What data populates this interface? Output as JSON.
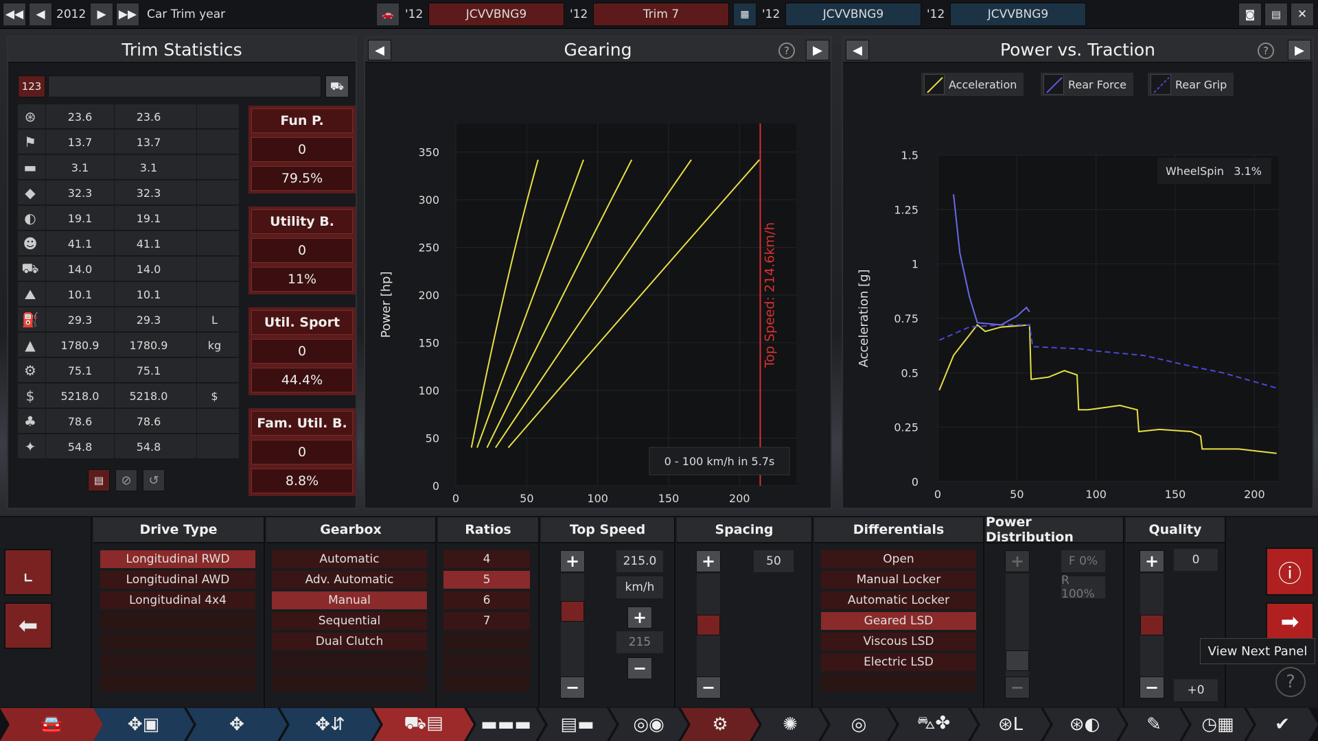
{
  "topbar": {
    "year": "2012",
    "car_trim_year_label": "Car Trim year",
    "slot1_year": "'12",
    "slot1_name": "JCVVBNG9",
    "slot2_year": "'12",
    "slot2_name": "Trim 7",
    "slot3_year": "'12",
    "slot3_name": "JCVVBNG9",
    "slot4_year": "'12",
    "slot4_name": "JCVVBNG9"
  },
  "trim_stats": {
    "title": "Trim Statistics",
    "search_prefix": "123",
    "rows": [
      {
        "icon": "steering-wheel-icon",
        "v1": "23.6",
        "v2": "23.6",
        "unit": ""
      },
      {
        "icon": "race-flag-icon",
        "v1": "13.7",
        "v2": "13.7",
        "unit": ""
      },
      {
        "icon": "seat-icon",
        "v1": "3.1",
        "v2": "3.1",
        "unit": ""
      },
      {
        "icon": "diamond-icon",
        "v1": "32.3",
        "v2": "32.3",
        "unit": ""
      },
      {
        "icon": "safety-icon",
        "v1": "19.1",
        "v2": "19.1",
        "unit": ""
      },
      {
        "icon": "passengers-icon",
        "v1": "41.1",
        "v2": "41.1",
        "unit": ""
      },
      {
        "icon": "cargo-icon",
        "v1": "14.0",
        "v2": "14.0",
        "unit": ""
      },
      {
        "icon": "offroad-icon",
        "v1": "10.1",
        "v2": "10.1",
        "unit": ""
      },
      {
        "icon": "fuel-icon",
        "v1": "29.3",
        "v2": "29.3",
        "unit": "L"
      },
      {
        "icon": "weight-icon",
        "v1": "1780.9",
        "v2": "1780.9",
        "unit": "kg"
      },
      {
        "icon": "service-icon",
        "v1": "75.1",
        "v2": "75.1",
        "unit": ""
      },
      {
        "icon": "cost-icon",
        "v1": "5218.0",
        "v2": "5218.0",
        "unit": "$"
      },
      {
        "icon": "environment-icon",
        "v1": "78.6",
        "v2": "78.6",
        "unit": ""
      },
      {
        "icon": "engineering-icon",
        "v1": "54.8",
        "v2": "54.8",
        "unit": ""
      }
    ],
    "scores": [
      {
        "name": "Fun P.",
        "rank": "0",
        "pct": "79.5%"
      },
      {
        "name": "Utility B.",
        "rank": "0",
        "pct": "11%"
      },
      {
        "name": "Util. Sport",
        "rank": "0",
        "pct": "44.4%"
      },
      {
        "name": "Fam. Util. B.",
        "rank": "0",
        "pct": "8.8%"
      }
    ]
  },
  "gearing": {
    "title": "Gearing",
    "top_speed_label": "Top Speed: 214.6km/h",
    "accel_label": "0 - 100 km/h in 5.7s"
  },
  "power_traction": {
    "title": "Power vs. Traction",
    "legend": [
      "Acceleration",
      "Rear Force",
      "Rear Grip"
    ],
    "wheelspin_label": "WheelSpin",
    "wheelspin_value": "3.1%"
  },
  "chart_data": [
    {
      "type": "line",
      "title": "Gearing",
      "xlabel": "Speed [km/h]",
      "ylabel": "Power [hp]",
      "xlim": [
        0,
        240
      ],
      "ylim": [
        0,
        380
      ],
      "xticks": [
        0,
        50,
        100,
        150,
        200
      ],
      "yticks": [
        0,
        50,
        100,
        150,
        200,
        250,
        300,
        350
      ],
      "series": [
        {
          "x": [
            11,
            35,
            58
          ],
          "y": [
            40,
            220,
            342
          ]
        },
        {
          "x": [
            15,
            55,
            90
          ],
          "y": [
            40,
            200,
            342
          ]
        },
        {
          "x": [
            22,
            75,
            124
          ],
          "y": [
            40,
            200,
            342
          ]
        },
        {
          "x": [
            28,
            100,
            166
          ],
          "y": [
            40,
            200,
            342
          ]
        },
        {
          "x": [
            37,
            130,
            214
          ],
          "y": [
            40,
            200,
            342
          ]
        }
      ],
      "top_speed": 214.6,
      "annotations": [
        "Top Speed: 214.6km/h",
        "0 - 100 km/h in 5.7s"
      ]
    },
    {
      "type": "line",
      "title": "Power vs. Traction",
      "xlabel": "Speed [km/h]",
      "ylabel": "Acceleration [g]",
      "xlim": [
        0,
        215
      ],
      "ylim": [
        0,
        1.5
      ],
      "xticks": [
        0,
        50,
        100,
        150,
        200
      ],
      "yticks": [
        "0",
        "0.25",
        "0.5",
        "0.75",
        "1",
        "1.25",
        "1.5"
      ],
      "series": [
        {
          "name": "Acceleration",
          "x": [
            1,
            10,
            25,
            30,
            40,
            58,
            59,
            70,
            80,
            88,
            89,
            95,
            105,
            115,
            126,
            127,
            140,
            160,
            166,
            167,
            190,
            214
          ],
          "y": [
            0.42,
            0.58,
            0.72,
            0.69,
            0.71,
            0.72,
            0.47,
            0.48,
            0.51,
            0.49,
            0.33,
            0.33,
            0.34,
            0.35,
            0.33,
            0.23,
            0.24,
            0.23,
            0.21,
            0.15,
            0.15,
            0.13
          ]
        },
        {
          "name": "Rear Force",
          "x": [
            1,
            20,
            40,
            58,
            60,
            90,
            100,
            130,
            160,
            180,
            214
          ],
          "y": [
            0.65,
            0.71,
            0.72,
            0.72,
            0.62,
            0.61,
            0.6,
            0.58,
            0.53,
            0.5,
            0.43
          ]
        },
        {
          "name": "Rear Grip",
          "x": [
            10,
            14,
            20,
            25,
            40,
            50,
            56,
            58
          ],
          "y": [
            1.32,
            1.05,
            0.85,
            0.73,
            0.72,
            0.76,
            0.8,
            0.78
          ]
        }
      ],
      "annotations": [
        "WheelSpin 3.1%"
      ]
    }
  ],
  "bottom": {
    "drive_type": {
      "title": "Drive Type",
      "options": [
        "Longitudinal RWD",
        "Longitudinal AWD",
        "Longitudinal 4x4"
      ],
      "selected": "Longitudinal RWD"
    },
    "gearbox": {
      "title": "Gearbox",
      "options": [
        "Automatic",
        "Adv. Automatic",
        "Manual",
        "Sequential",
        "Dual Clutch"
      ],
      "selected": "Manual"
    },
    "ratios": {
      "title": "Ratios",
      "options": [
        "4",
        "5",
        "6",
        "7"
      ],
      "selected": "5"
    },
    "top_speed": {
      "title": "Top Speed",
      "value": "215.0",
      "unit": "km/h",
      "secondary": "215"
    },
    "spacing": {
      "title": "Spacing",
      "value": "50"
    },
    "differentials": {
      "title": "Differentials",
      "options": [
        "Open",
        "Manual Locker",
        "Automatic Locker",
        "Geared LSD",
        "Viscous LSD",
        "Electric LSD"
      ],
      "selected": "Geared LSD"
    },
    "power_distribution": {
      "title": "Power Distribution",
      "front": "F 0%",
      "rear": "R 100%"
    },
    "quality": {
      "title": "Quality",
      "value": "0",
      "delta": "+0"
    },
    "tooltip": "View Next Panel"
  },
  "colors": {
    "accent_red": "#8a2a2a",
    "chart_yellow": "#e8e044",
    "chart_blue": "#4a4ad8",
    "marker_red": "#d83030"
  },
  "nav_icons": [
    "car-body-icon",
    "engine-parts-icon",
    "engine-icon",
    "engine-tune-icon",
    "trim-icon",
    "car-line-icon",
    "fixtures-icon",
    "interior-icon",
    "gearbox-icon",
    "wheels-icon",
    "brakes-icon",
    "aero-icon",
    "suspension-icon",
    "safety-icon",
    "paint-icon",
    "testing-icon",
    "finish-icon"
  ]
}
